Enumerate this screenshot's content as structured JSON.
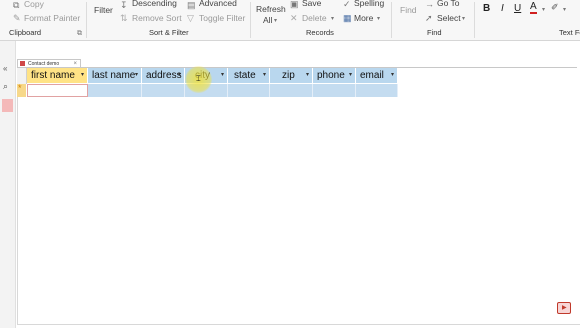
{
  "ribbon": {
    "clipboard": {
      "copy": "Copy",
      "format_painter": "Format Painter",
      "label": "Clipboard"
    },
    "sort_filter": {
      "filter": "Filter",
      "descending": "Descending",
      "remove_sort": "Remove Sort",
      "advanced": "Advanced",
      "toggle_filter": "Toggle Filter",
      "label": "Sort & Filter"
    },
    "records": {
      "refresh": "Refresh",
      "all": "All",
      "save": "Save",
      "delete": "Delete",
      "spelling": "Spelling",
      "more": "More",
      "label": "Records"
    },
    "find": {
      "find": "Find",
      "goto": "Go To",
      "select": "Select",
      "label": "Find"
    },
    "text_formatting": {
      "bold": "B",
      "italic": "I",
      "underline": "U",
      "font_color": "A",
      "label": "Text Fo"
    }
  },
  "document_tab": {
    "label": "Contact demo",
    "close": "×"
  },
  "datasheet": {
    "columns": [
      "first name",
      "last name",
      "address",
      "city",
      "state",
      "zip",
      "phone",
      "email"
    ],
    "new_row_marker": "*"
  },
  "colors": {
    "header_blue": "#b9d7ee",
    "header_active": "#ffe386",
    "row_blue": "#c4dcf0",
    "cursor_highlight": "#f0e13c"
  }
}
